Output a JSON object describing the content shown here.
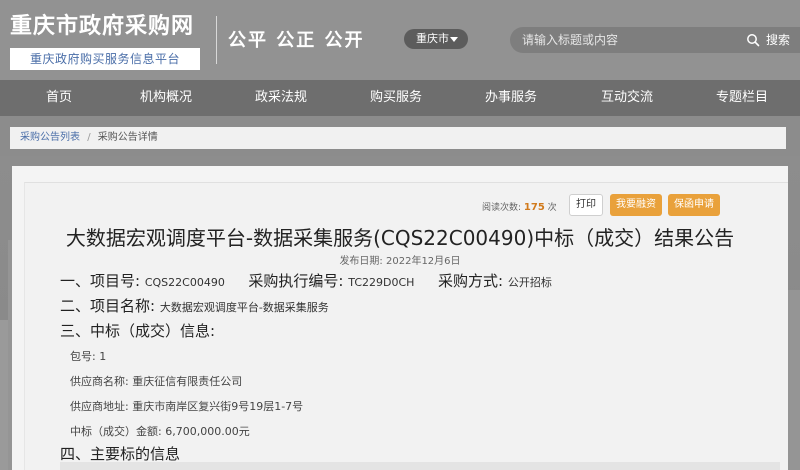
{
  "header": {
    "site_title": "重庆市政府采购网",
    "site_subtitle": "重庆政府购买服务信息平台",
    "slogan": "公平 公正 公开",
    "region": "重庆市",
    "search": {
      "placeholder": "请输入标题或内容",
      "button_label": "搜索"
    }
  },
  "nav": {
    "items": [
      {
        "label": "首页"
      },
      {
        "label": "机构概况"
      },
      {
        "label": "政采法规"
      },
      {
        "label": "购买服务"
      },
      {
        "label": "办事服务"
      },
      {
        "label": "互动交流"
      },
      {
        "label": "专题栏目"
      }
    ]
  },
  "breadcrumb": {
    "link": "采购公告列表",
    "separator": "/",
    "current": "采购公告详情"
  },
  "toolbar": {
    "views_label": "阅读次数:",
    "views_count": "175",
    "views_unit": "次",
    "print_label": "打印",
    "finance_label": "我要融资",
    "insurance_label": "保函申请"
  },
  "notice": {
    "title": "大数据宏观调度平台-数据采集服务(CQS22C00490)中标（成交）结果公告",
    "publish_label": "发布日期:",
    "publish_date": "2022年12月6日",
    "section1": {
      "heading": "一、项目号:",
      "project_no": "CQS22C00490",
      "exec_label": "采购执行编号:",
      "exec_no": "TC229D0CH",
      "method_label": "采购方式:",
      "method": "公开招标"
    },
    "section2": {
      "heading": "二、项目名称:",
      "name": "大数据宏观调度平台-数据采集服务"
    },
    "section3": {
      "heading": "三、中标（成交）信息:",
      "package_label": "包号:",
      "package": "1",
      "supplier_label": "供应商名称:",
      "supplier": "重庆征信有限责任公司",
      "address_label": "供应商地址:",
      "address": "重庆市南岸区复兴街9号19层1-7号",
      "amount_label": "中标（成交）金额:",
      "amount": "6,700,000.00元"
    },
    "section4": {
      "heading": "四、主要标的信息"
    }
  },
  "colors": {
    "accent_orange": "#e9a13b",
    "link_blue": "#4a6ea8",
    "nav_bg": "#6e6e6e"
  },
  "icons": {
    "search": "search-icon",
    "dropdown": "chevron-down-icon"
  }
}
